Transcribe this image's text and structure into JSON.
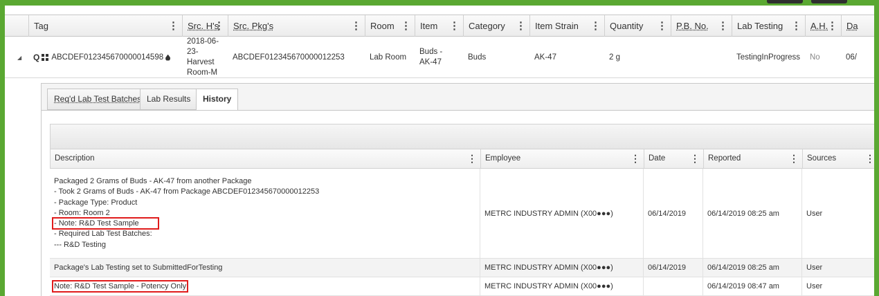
{
  "columns": [
    {
      "label": "Tag",
      "underline": false
    },
    {
      "label": "Src. H's",
      "underline": true
    },
    {
      "label": "Src. Pkg's",
      "underline": true
    },
    {
      "label": "Room",
      "underline": false
    },
    {
      "label": "Item",
      "underline": false
    },
    {
      "label": "Category",
      "underline": false
    },
    {
      "label": "Item Strain",
      "underline": false
    },
    {
      "label": "Quantity",
      "underline": false
    },
    {
      "label": "P.B. No.",
      "underline": true
    },
    {
      "label": "Lab Testing",
      "underline": false
    },
    {
      "label": "A.H.",
      "underline": true
    },
    {
      "label": "Da",
      "underline": true
    }
  ],
  "package": {
    "tag": "ABCDEF012345670000014598",
    "src_harvest_lines": [
      "2018-06-23-",
      "Harvest",
      "Room-M"
    ],
    "src_pkg": "ABCDEF012345670000012253",
    "room": "Lab Room",
    "item_lines": [
      "Buds -",
      "AK-47"
    ],
    "category": "Buds",
    "strain": "AK-47",
    "quantity": "2 g",
    "pb_no": "",
    "lab_testing": "TestingInProgress",
    "ah": "No",
    "date_partial": "06/"
  },
  "tabs": [
    {
      "label": "Req'd Lab Test Batches"
    },
    {
      "label": "Lab Results"
    },
    {
      "label": "History"
    }
  ],
  "history": {
    "columns": [
      "Description",
      "Employee",
      "Date",
      "Reported",
      "Sources"
    ],
    "rows": [
      {
        "desc_lines": [
          "Packaged 2 Grams of Buds - AK-47 from another Package",
          "- Took 2 Grams of Buds - AK-47 from Package ABCDEF012345670000012253",
          "- Package Type: Product",
          "- Room: Room 2",
          "- Note: R&D Test Sample",
          "- Required Lab Test Batches:",
          "--- R&D Testing"
        ],
        "employee": "METRC INDUSTRY ADMIN (X00●●●)",
        "date": "06/14/2019",
        "reported": "06/14/2019 08:25 am",
        "source": "User"
      },
      {
        "desc_lines": [
          "Package's Lab Testing set to SubmittedForTesting"
        ],
        "employee": "METRC INDUSTRY ADMIN (X00●●●)",
        "date": "06/14/2019",
        "reported": "06/14/2019 08:25 am",
        "source": "User"
      },
      {
        "desc_lines": [
          "Note: R&D Test Sample - Potency Only"
        ],
        "employee": "METRC INDUSTRY ADMIN (X00●●●)",
        "date": "",
        "reported": "06/14/2019 08:47 am",
        "source": "User"
      }
    ]
  },
  "colors": {
    "frame": "#5aa832",
    "highlight": "#e01b1b"
  }
}
